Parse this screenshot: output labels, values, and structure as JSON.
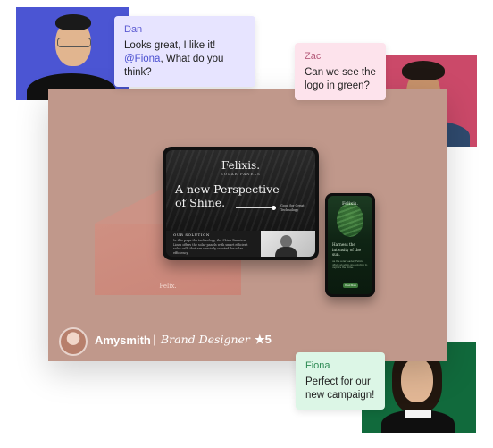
{
  "mockup": {
    "tablet": {
      "logo": "Felixis.",
      "tagline": "SOLAR PANELS",
      "headline": "A new Perspective of Shine.",
      "side_note": "Good for Great Technology",
      "section_title": "OUR SOLUTION",
      "body": "In this page the technology, the Shine Premium Lines offers the solar panels with smart efficient solar cells that are specially created for solar efficiency."
    },
    "phone": {
      "logo": "Felixis.",
      "headline": "Harness the intensity of the sun.",
      "body": "As the solar leader, Felixis offers an all-in-one solution to capture the shine.",
      "cta": "Read More"
    },
    "envelope": {
      "brand": "Felix."
    }
  },
  "designer": {
    "name": "Amysmith",
    "separator": "|",
    "role": "Brand Designer",
    "rating": "★5"
  },
  "comments": [
    {
      "author": "Dan",
      "line1": "Looks great, I like it!",
      "mention": "@Fiona",
      "line2": ", What do you think?"
    },
    {
      "author": "Zac",
      "text": "Can we see the logo in green?"
    },
    {
      "author": "Fiona",
      "text": "Perfect for our new campaign!"
    }
  ]
}
